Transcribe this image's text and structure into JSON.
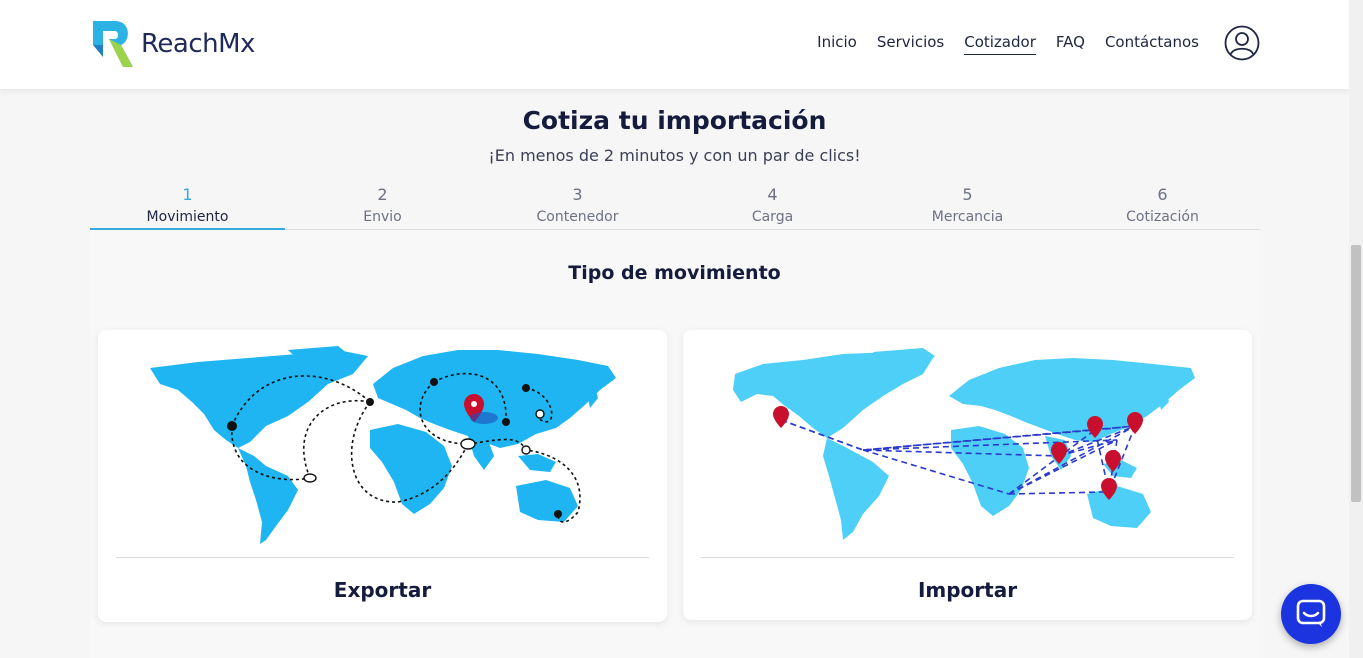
{
  "header": {
    "brand": "ReachMx",
    "nav": [
      {
        "label": "Inicio",
        "active": false
      },
      {
        "label": "Servicios",
        "active": false
      },
      {
        "label": "Cotizador",
        "active": true
      },
      {
        "label": "FAQ",
        "active": false
      },
      {
        "label": "Contáctanos",
        "active": false
      }
    ]
  },
  "page": {
    "title": "Cotiza tu importación",
    "subtitle": "¡En menos de 2 minutos y con un par de clics!"
  },
  "steps": [
    {
      "num": "1",
      "label": "Movimiento",
      "active": true
    },
    {
      "num": "2",
      "label": "Envio",
      "active": false
    },
    {
      "num": "3",
      "label": "Contenedor",
      "active": false
    },
    {
      "num": "4",
      "label": "Carga",
      "active": false
    },
    {
      "num": "5",
      "label": "Mercancia",
      "active": false
    },
    {
      "num": "6",
      "label": "Cotización",
      "active": false
    }
  ],
  "section": {
    "title": "Tipo de movimiento"
  },
  "options": {
    "export_label": "Exportar",
    "import_label": "Importar"
  },
  "colors": {
    "accent": "#35a8e0",
    "map_blue": "#1fb5f2",
    "map_light": "#4dcff7",
    "chat": "#1b34e0",
    "pin": "#c8102e"
  }
}
